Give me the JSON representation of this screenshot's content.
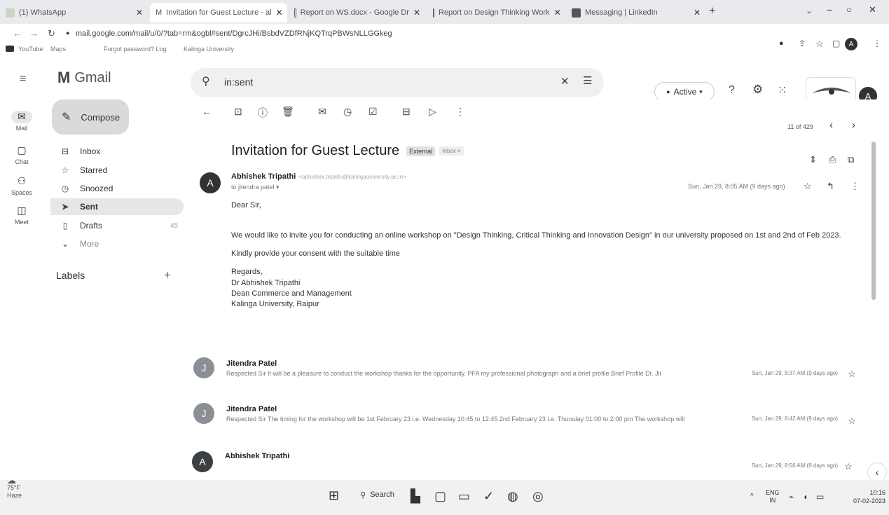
{
  "tabs": [
    {
      "label": "(1) WhatsApp"
    },
    {
      "label": "Invitation for Guest Lecture - al"
    },
    {
      "label": "Report on WS.docx - Google Dr"
    },
    {
      "label": "Report on Design Thinking Work"
    },
    {
      "label": "Messaging | LinkedIn"
    }
  ],
  "address": {
    "url": "mail.google.com/mail/u/0/?tab=rm&ogbl#sent/DgrcJHi/BsbdVZDfRNjKQTrqPBWsNLLGGkeg"
  },
  "bookmarks": [
    "YouTube",
    "Maps",
    "Forgot password? Log",
    "Kalinga University"
  ],
  "gmail": {
    "logo": "Gmail",
    "compose": "Compose",
    "search_value": "in:sent",
    "status": "Active"
  },
  "rail": [
    {
      "label": "Mail"
    },
    {
      "label": "Chat"
    },
    {
      "label": "Spaces"
    },
    {
      "label": "Meet"
    }
  ],
  "nav": [
    {
      "label": "Inbox",
      "count": ""
    },
    {
      "label": "Starred",
      "count": ""
    },
    {
      "label": "Snoozed",
      "count": ""
    },
    {
      "label": "Sent",
      "count": ""
    },
    {
      "label": "Drafts",
      "count": "45"
    },
    {
      "label": "More",
      "count": ""
    }
  ],
  "labels_heading": "Labels",
  "pager": "11 of 429",
  "email": {
    "subject": "Invitation for Guest Lecture",
    "badge_external": "External",
    "badge_inbox": "Inbox ×",
    "sender_name": "Abhishek Tripathi",
    "sender_email": "<abhishek.tripathi@kalingauniversity.ac.in>",
    "to_line": "to jitendra patel ▾",
    "date": "Sun, Jan 29, 8:05 AM (9 days ago)",
    "greeting": "Dear Sir,",
    "para1": "We would like to invite you for conducting an online workshop on \"Design Thinking, Critical Thinking and Innovation Design\" in our university proposed on 1st and 2nd of Feb 2023.",
    "para2": "Kindly provide your consent with the suitable time",
    "sign": [
      "Regards,",
      "Dr Abhishek Tripathi",
      "Dean Commerce and Management",
      "Kalinga University, Raipur"
    ],
    "avatar_letter": "A"
  },
  "thread": [
    {
      "name": "Jitendra Patel",
      "snippet": "Respected Sir It will be a pleasure to conduct the workshop thanks for the opportunity. PFA my professional photograph and a brief profile Brief Profile Dr. Jit",
      "date": "Sun, Jan 29, 8:37 AM (9 days ago)",
      "avatar": "J",
      "color": "#8a8f96"
    },
    {
      "name": "Jitendra Patel",
      "snippet": "Respected Sir The timing for the workshop will be 1st February 23 i.e. Wednesday 10:45 to 12:45 2nd February 23 i.e. Thursday 01:00 to 2:00 pm The workshop will",
      "date": "Sun, Jan 29, 8:42 AM (9 days ago)",
      "avatar": "J",
      "color": "#8a8f96"
    },
    {
      "name": "Abhishek Tripathi",
      "snippet": "",
      "date": "Sun, Jan 29, 8:56 AM (9 days ago)",
      "avatar": "A",
      "color": "#3c4043"
    }
  ],
  "weather": {
    "temp": "75°F",
    "cond": "Haze"
  },
  "taskbar": {
    "search": "Search",
    "lang": "ENG",
    "region": "IN",
    "time": "10:16",
    "date": "07-02-2023"
  }
}
